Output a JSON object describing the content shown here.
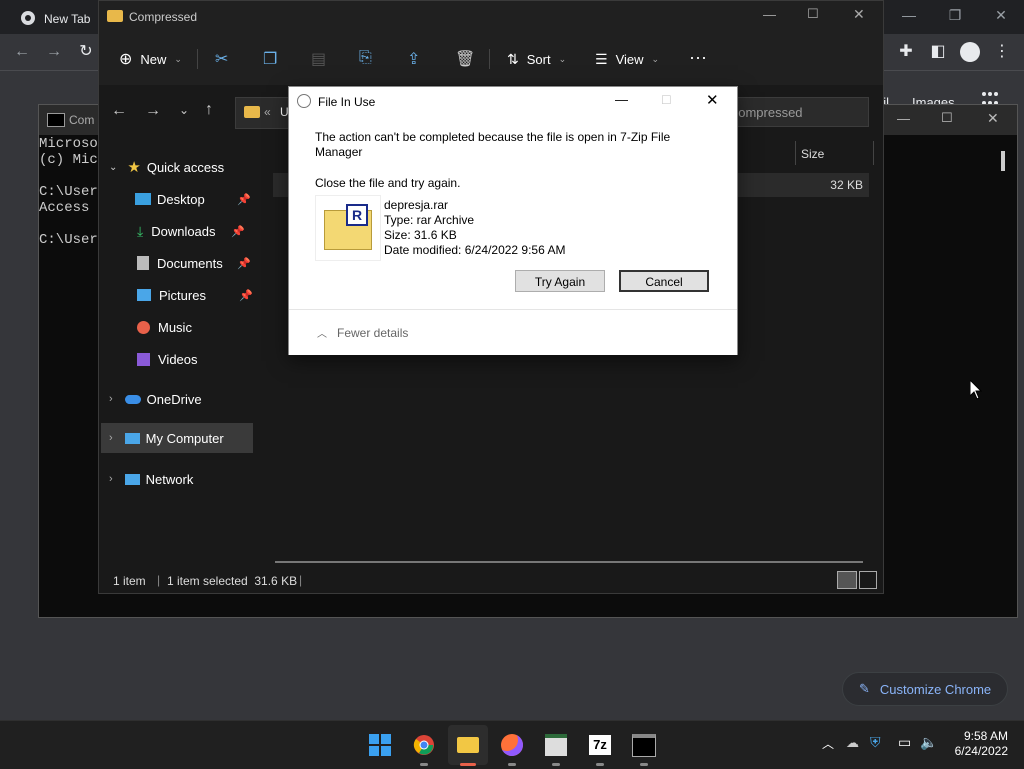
{
  "chrome": {
    "tab_title": "New Tab",
    "links": [
      "ail",
      "Images"
    ],
    "customize_label": "Customize Chrome",
    "icons": [
      "chrome-logo-icon",
      "back-icon",
      "forward-icon",
      "reload-icon",
      "extensions-icon",
      "sidepanel-icon",
      "profile-icon",
      "menu-icon",
      "apps-icon",
      "pencil-icon"
    ]
  },
  "cmd": {
    "title": "Com",
    "lines": [
      "Microso",
      "(c) Mic",
      "",
      "C:\\Users",
      "Access i",
      "",
      "C:\\Users"
    ]
  },
  "explorer": {
    "title": "Compressed",
    "commandbar": {
      "new_label": "New",
      "sort_label": "Sort",
      "view_label": "View"
    },
    "address_prefix": "U",
    "search_placeholder": "h Compressed",
    "columns": {
      "size": "Size"
    },
    "row": {
      "size": "32 KB"
    },
    "sidebar": {
      "quick_access": "Quick access",
      "items": [
        {
          "label": "Desktop",
          "pinned": true
        },
        {
          "label": "Downloads",
          "pinned": true
        },
        {
          "label": "Documents",
          "pinned": true
        },
        {
          "label": "Pictures",
          "pinned": true
        },
        {
          "label": "Music",
          "pinned": false
        },
        {
          "label": "Videos",
          "pinned": false
        }
      ],
      "onedrive": "OneDrive",
      "my_computer": "My Computer",
      "network": "Network"
    },
    "status": {
      "items": "1 item",
      "selected": "1 item selected  31.6 KB"
    }
  },
  "dialog": {
    "title": "File In Use",
    "message": "The action can't be completed because the file is open in 7-Zip File Manager",
    "instruction": "Close the file and try again.",
    "file": {
      "name": "depresja.rar",
      "type": "Type: rar Archive",
      "size": "Size: 31.6 KB",
      "modified": "Date modified: 6/24/2022 9:56 AM"
    },
    "try_again_label": "Try Again",
    "cancel_label": "Cancel",
    "fewer_details_label": "Fewer details"
  },
  "taskbar": {
    "time": "9:58 AM",
    "date": "6/24/2022",
    "apps": [
      "windows-start-icon",
      "chrome-icon",
      "file-explorer-icon",
      "firefox-icon",
      "notepad-icon",
      "7zip-icon",
      "terminal-icon"
    ],
    "sevenzip_label": "7z"
  },
  "colors": {
    "accent": "#0078d4",
    "dialog_bg": "#ffffff",
    "explorer_bg": "#191919",
    "taskbar_bg": "#202020"
  }
}
